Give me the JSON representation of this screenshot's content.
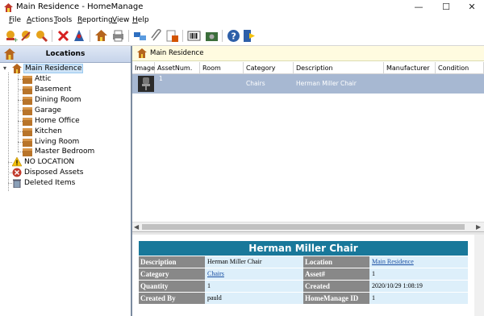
{
  "window": {
    "title": "Main Residence - HomeManage",
    "minimize": "—",
    "maximize": "☐",
    "close": "✕"
  },
  "menu": [
    "File",
    "Actions",
    "Tools",
    "Reporting",
    "View",
    "Help"
  ],
  "menu_accel": [
    "F",
    "A",
    "T",
    "R",
    "V",
    "H"
  ],
  "toolbar_icons": [
    "add-asset-icon",
    "add-location-icon",
    "add-item-icon",
    "delete-icon",
    "wizard-icon",
    "house-icon",
    "print-icon",
    "move-icon",
    "attach-icon",
    "export-icon",
    "barcode-icon",
    "camera-icon",
    "help-icon",
    "exit-icon"
  ],
  "left": {
    "header": "Locations",
    "tree": [
      {
        "label": "Main Residence",
        "icon": "house-icon",
        "selected": true
      },
      {
        "label": "Attic",
        "icon": "box-icon"
      },
      {
        "label": "Basement",
        "icon": "box-icon"
      },
      {
        "label": "Dining Room",
        "icon": "box-icon"
      },
      {
        "label": "Garage",
        "icon": "box-icon"
      },
      {
        "label": "Home Office",
        "icon": "box-icon"
      },
      {
        "label": "Kitchen",
        "icon": "box-icon"
      },
      {
        "label": "Living Room",
        "icon": "box-icon"
      },
      {
        "label": "Master Bedroom",
        "icon": "box-icon"
      },
      {
        "label": "NO LOCATION",
        "icon": "warning-icon"
      },
      {
        "label": "Disposed Assets",
        "icon": "disposed-icon"
      },
      {
        "label": "Deleted Items",
        "icon": "trash-icon"
      }
    ]
  },
  "breadcrumb": "Main Residence",
  "grid": {
    "columns": [
      "Image",
      "AssetNum.",
      "Room",
      "Category",
      "Description",
      "Manufacturer",
      "Condition"
    ],
    "rows": [
      {
        "asset_num": "1",
        "room": "",
        "category": "Chairs",
        "description": "Herman Miller Chair",
        "manufacturer": "",
        "condition": ""
      }
    ]
  },
  "detail": {
    "title": "Herman Miller Chair",
    "rows": [
      {
        "l1": "Description",
        "v1": "Herman Miller Chair",
        "l2": "Location",
        "v2": "Main Residence",
        "v2_link": true
      },
      {
        "l1": "Category",
        "v1": "Chairs",
        "v1_link": true,
        "l2": "Asset#",
        "v2": "1"
      },
      {
        "l1": "Quantity",
        "v1": "1",
        "l2": "Created",
        "v2": "2020/10/29 1:08:19"
      },
      {
        "l1": "Created By",
        "v1": "pauld",
        "l2": "HomeManage ID",
        "v2": "1"
      }
    ]
  },
  "colors": {
    "title_bar": "#19789a",
    "selected_row": "#a7b8d2",
    "label_cell": "#888888",
    "value_cell": "#ddeffa"
  }
}
